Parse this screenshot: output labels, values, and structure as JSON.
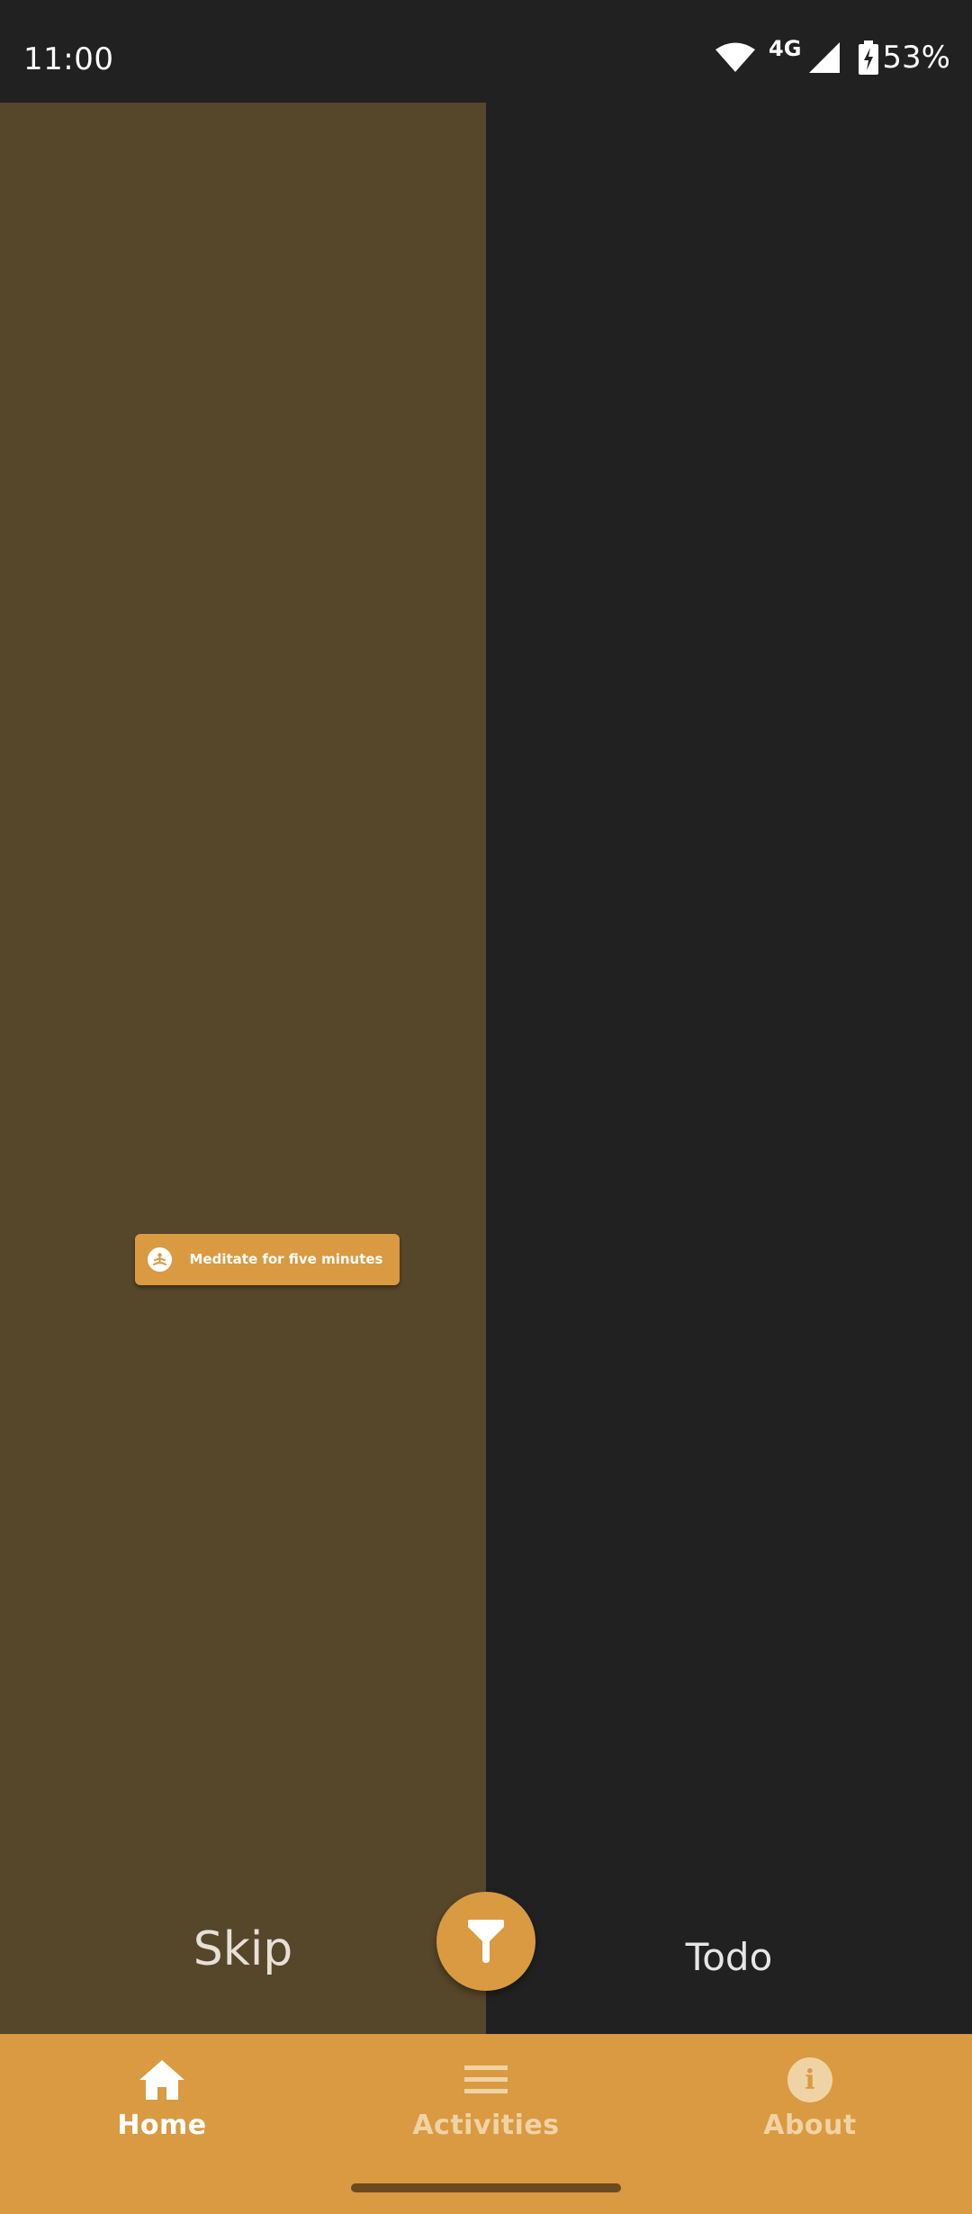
{
  "status_bar": {
    "time": "11:00",
    "network": "4G",
    "battery": "53%",
    "icons": [
      "wifi-icon",
      "signal-icon",
      "battery-charging-icon"
    ]
  },
  "columns": {
    "skip": {
      "label": "Skip",
      "background": "#56462a"
    },
    "todo": {
      "label": "Todo",
      "background": "#212121"
    }
  },
  "activity": {
    "label": "Meditate for five minutes",
    "icon": "meditation-icon",
    "color": "#d99a41"
  },
  "filter_button": {
    "icon": "filter-icon",
    "color": "#d99a41"
  },
  "bottom_nav": {
    "background": "#d99a41",
    "items": [
      {
        "label": "Home",
        "icon": "home-icon",
        "active": true
      },
      {
        "label": "Activities",
        "icon": "list-icon",
        "active": false
      },
      {
        "label": "About",
        "icon": "info-icon",
        "active": false
      }
    ]
  }
}
